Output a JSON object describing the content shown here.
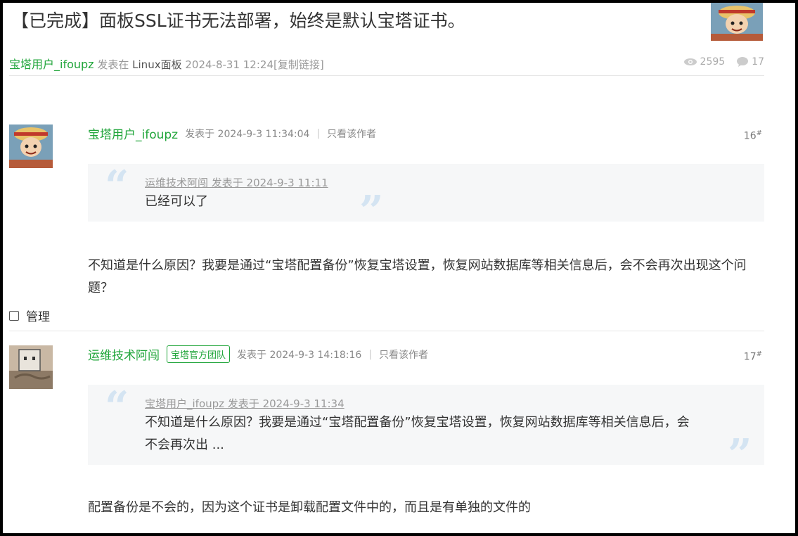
{
  "thread": {
    "title": "【已完成】面板SSL证书无法部署，始终是默认宝塔证书。",
    "author": "宝塔用户_ifoupz",
    "posted_in_label": "发表在",
    "board": "Linux面板",
    "date": "2024-8-31 12:24",
    "copy_link": "[复制链接]",
    "views": "2595",
    "replies": "17"
  },
  "posts": [
    {
      "author": "宝塔用户_ifoupz",
      "badge": "",
      "posted_label": "发表于 2024-9-3 11:34:04",
      "only_author": "只看该作者",
      "floor": "16",
      "floor_mark": "#",
      "quote_ref": "运维技术阿闯 发表于 2024-9-3 11:11",
      "quote_text": "已经可以了",
      "body": "不知道是什么原因？我要是通过“宝塔配置备份”恢复宝塔设置，恢复网站数据库等相关信息后，会不会再次出现这个问题？",
      "manage": "管理"
    },
    {
      "author": "运维技术阿闯",
      "badge": "宝塔官方团队",
      "posted_label": "发表于 2024-9-3 14:18:16",
      "only_author": "只看该作者",
      "floor": "17",
      "floor_mark": "#",
      "quote_ref": "宝塔用户_ifoupz 发表于 2024-9-3 11:34",
      "quote_text": "不知道是什么原因？我要是通过“宝塔配置备份”恢复宝塔设置，恢复网站数据库等相关信息后，会不会再次出 ...",
      "body": "配置备份是不会的，因为这个证书是卸载配置文件中的，而且是有单独的文件的"
    }
  ],
  "colors": {
    "accent": "#20a53a",
    "quote_bg": "#f6f7f8"
  }
}
